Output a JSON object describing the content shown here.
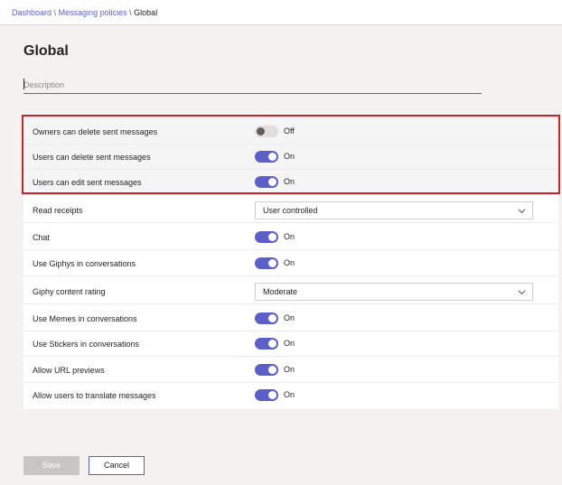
{
  "breadcrumb": {
    "items": [
      "Dashboard",
      "Messaging policies",
      "Global"
    ],
    "separator": "\\"
  },
  "page": {
    "title": "Global"
  },
  "description": {
    "placeholder": "Description",
    "value": ""
  },
  "settings": [
    {
      "label": "Owners can delete sent messages",
      "type": "toggle",
      "state": "Off",
      "highlighted": true
    },
    {
      "label": "Users can delete sent messages",
      "type": "toggle",
      "state": "On",
      "highlighted": true
    },
    {
      "label": "Users can edit sent messages",
      "type": "toggle",
      "state": "On",
      "highlighted": true
    },
    {
      "label": "Read receipts",
      "type": "select",
      "value": "User controlled"
    },
    {
      "label": "Chat",
      "type": "toggle",
      "state": "On"
    },
    {
      "label": "Use Giphys in conversations",
      "type": "toggle",
      "state": "On"
    },
    {
      "label": "Giphy content rating",
      "type": "select",
      "value": "Moderate"
    },
    {
      "label": "Use Memes in conversations",
      "type": "toggle",
      "state": "On"
    },
    {
      "label": "Use Stickers in conversations",
      "type": "toggle",
      "state": "On"
    },
    {
      "label": "Allow URL previews",
      "type": "toggle",
      "state": "On"
    },
    {
      "label": "Allow users to translate messages",
      "type": "toggle",
      "state": "On"
    }
  ],
  "actions": {
    "save_label": "Save",
    "cancel_label": "Cancel"
  },
  "colors": {
    "accent": "#5b5fc7",
    "highlight_border": "#c4262e",
    "toggle_off": "#e1dfdd",
    "disabled_button": "#c8c6c4"
  }
}
